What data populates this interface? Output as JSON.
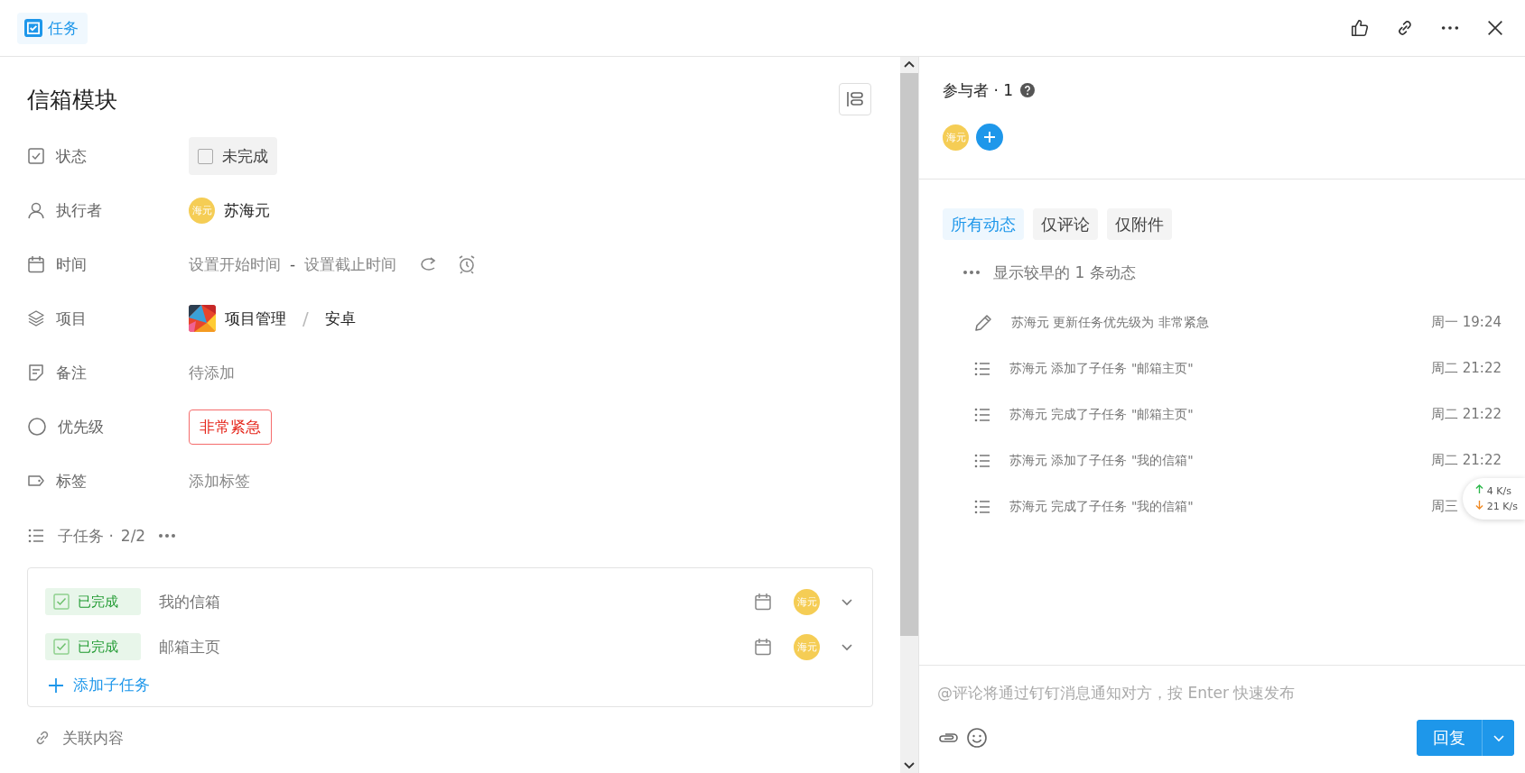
{
  "header": {
    "tab": "任务"
  },
  "task": {
    "title": "信箱模块",
    "fields": [
      {
        "kind": "status",
        "label": "状态",
        "value": "未完成",
        "checked": false
      },
      {
        "kind": "assignee",
        "label": "执行者",
        "avatar": "海元",
        "value": "苏海元"
      },
      {
        "kind": "time",
        "label": "时间",
        "start": "设置开始时间",
        "separator": "-",
        "end": "设置截止时间"
      },
      {
        "kind": "project",
        "label": "项目",
        "project": "项目管理",
        "separator": "/",
        "section": "安卓"
      },
      {
        "kind": "note",
        "label": "备注",
        "placeholder": "待添加"
      },
      {
        "kind": "priority",
        "label": "优先级",
        "value": "非常紧急"
      },
      {
        "kind": "tags",
        "label": "标签",
        "placeholder": "添加标签"
      }
    ],
    "subtasks": {
      "label": "子任务 ·",
      "count": "2/2",
      "items": [
        {
          "status": "已完成",
          "checked": true,
          "title": "我的信箱",
          "avatar": "海元"
        },
        {
          "status": "已完成",
          "checked": true,
          "title": "邮箱主页",
          "avatar": "海元"
        }
      ],
      "add": "添加子任务"
    },
    "related": "关联内容"
  },
  "participants": {
    "label": "参与者 · 1",
    "avatars": [
      "海元"
    ]
  },
  "activity": {
    "filters": [
      {
        "label": "所有动态",
        "selected": true
      },
      {
        "label": "仅评论",
        "selected": false
      },
      {
        "label": "仅附件",
        "selected": false
      }
    ],
    "more": "显示较早的 1 条动态",
    "items": [
      {
        "kind": "edit",
        "text": "苏海元 更新任务优先级为 非常紧急",
        "time": "周一 19:24"
      },
      {
        "kind": "subtask",
        "text": "苏海元 添加了子任务 \"邮箱主页\"",
        "time": "周二 21:22"
      },
      {
        "kind": "subtask",
        "text": "苏海元 完成了子任务 \"邮箱主页\"",
        "time": "周二 21:22"
      },
      {
        "kind": "subtask",
        "text": "苏海元 添加了子任务 \"我的信箱\"",
        "time": "周二 21:22"
      },
      {
        "kind": "subtask",
        "text": "苏海元 完成了子任务 \"我的信箱\"",
        "time": "周三"
      }
    ]
  },
  "comment": {
    "placeholder": "@评论将通过钉钉消息通知对方，按 Enter 快速发布",
    "button": "回复"
  },
  "speed_widget": {
    "up": "4",
    "up_unit": "K/s",
    "down": "21",
    "down_unit": "K/s"
  }
}
